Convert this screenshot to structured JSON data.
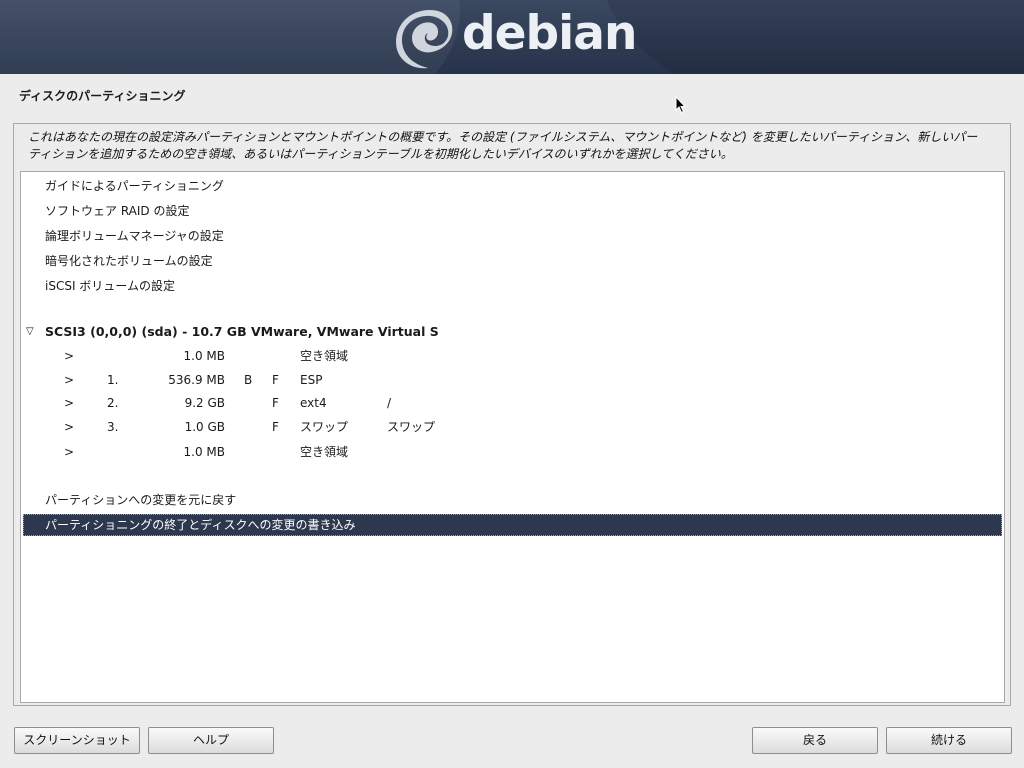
{
  "banner": {
    "logo_text": "debian"
  },
  "page": {
    "title": "ディスクのパーティショニング",
    "intro_lines": [
      "これはあなたの現在の設定済みパーティションとマウントポイントの概要です。その設定 (ファイルシステム、マウントポイントなど) を変更したいパーティション、新しいパー",
      "ティションを追加するための空き領域、あるいはパーティションテーブルを初期化したいデバイスのいずれかを選択してください。"
    ]
  },
  "menu": {
    "items": [
      "ガイドによるパーティショニング",
      "ソフトウェア RAID の設定",
      "論理ボリュームマネージャの設定",
      "暗号化されたボリュームの設定",
      "iSCSI ボリュームの設定"
    ]
  },
  "disk": {
    "twisty": "▽",
    "label": "SCSI3 (0,0,0) (sda) - 10.7 GB VMware, VMware Virtual S",
    "partitions": [
      {
        "arrow": ">",
        "num": "",
        "size": "1.0 MB",
        "boot": "",
        "format": "",
        "fs": "空き領域",
        "mount": ""
      },
      {
        "arrow": ">",
        "num": "1.",
        "size": "536.9 MB",
        "boot": "B",
        "format": "F",
        "fs": "ESP",
        "mount": ""
      },
      {
        "arrow": ">",
        "num": "2.",
        "size": "9.2 GB",
        "boot": "",
        "format": "F",
        "fs": "ext4",
        "mount": "/"
      },
      {
        "arrow": ">",
        "num": "3.",
        "size": "1.0 GB",
        "boot": "",
        "format": "F",
        "fs": "スワップ",
        "mount": "スワップ"
      },
      {
        "arrow": ">",
        "num": "",
        "size": "1.0 MB",
        "boot": "",
        "format": "",
        "fs": "空き領域",
        "mount": ""
      }
    ]
  },
  "actions": {
    "undo": "パーティションへの変更を元に戻す",
    "finish": "パーティショニングの終了とディスクへの変更の書き込み"
  },
  "buttons": {
    "screenshot": "スクリーンショット",
    "help": "ヘルプ",
    "back": "戻る",
    "continue": "続ける"
  },
  "colors": {
    "banner": "#2e3b52",
    "selection": "#2d384f",
    "background": "#ececec"
  }
}
